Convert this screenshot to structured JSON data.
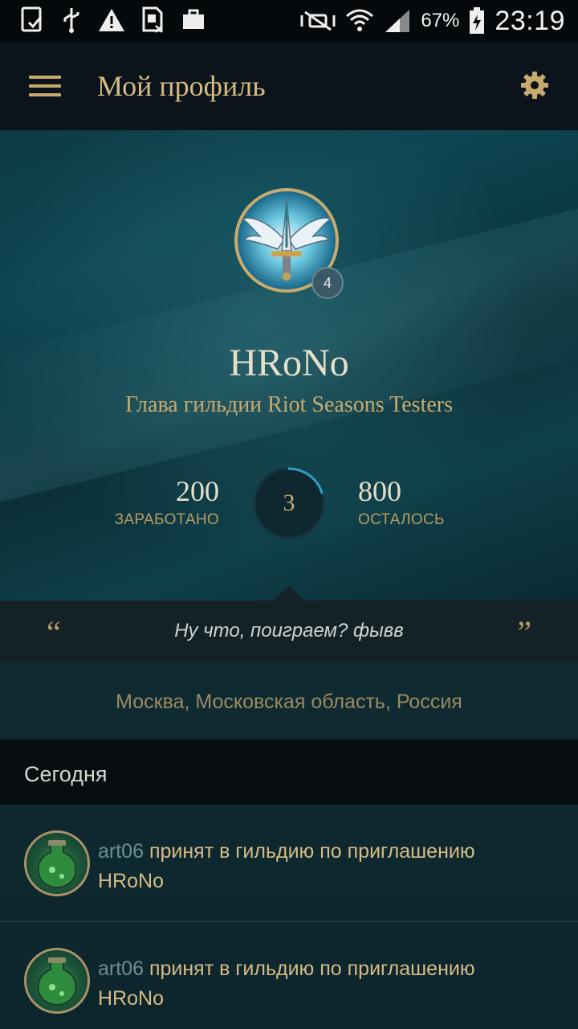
{
  "status_bar": {
    "battery_percent": "67%",
    "time": "23:19",
    "icons": [
      "screenshot-icon",
      "usb-icon",
      "warning-icon",
      "sim-icon",
      "briefcase-icon",
      "mute-icon",
      "wifi-icon",
      "signal-icon",
      "battery-charging-icon"
    ]
  },
  "app_bar": {
    "title": "Мой профиль",
    "menu_icon": "hamburger-icon",
    "settings_icon": "gear-icon"
  },
  "profile": {
    "name": "HRoNo",
    "title": "Глава гильдии Riot Seasons Testers",
    "level": "4",
    "earned_value": "200",
    "earned_label": "ЗАРАБОТАНО",
    "progress_value": "3",
    "progress_fraction": 0.2,
    "remaining_value": "800",
    "remaining_label": "ОСТАЛОСЬ"
  },
  "quote": {
    "open_mark": "“",
    "text": "Ну что, поиграем? фывв",
    "close_mark": "”"
  },
  "location": "Москва, Московская область, Россия",
  "feed": {
    "section_title": "Сегодня",
    "items": [
      {
        "user": "art06",
        "action": "принят в гильдию по приглашению",
        "target": "HRoNo"
      },
      {
        "user": "art06",
        "action": "принят в гильдию по приглашению",
        "target": "HRoNo"
      }
    ]
  },
  "colors": {
    "gold": "#c9aa6e",
    "accent_blue": "#2f9fc4"
  }
}
